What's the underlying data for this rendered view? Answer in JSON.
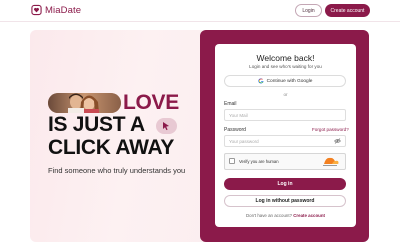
{
  "header": {
    "brand_name": "MiaDate",
    "login_label": "Login",
    "create_account_label": "Create account"
  },
  "hero": {
    "word_highlight": "LOVE",
    "line2": "IS JUST A",
    "line3": "CLICK AWAY",
    "subtitle": "Find someone who truly understands you"
  },
  "login_card": {
    "title": "Welcome back!",
    "subtitle": "Login and see who's waiting for you",
    "google_button_label": "Continue with Google",
    "divider_text": "or",
    "email_label": "Email",
    "email_placeholder": "Your Mail",
    "password_label": "Password",
    "forgot_password_label": "Forgot password?",
    "password_placeholder": "Your password",
    "captcha_label": "Verify you are human",
    "login_button_label": "Log in",
    "login_without_password_label": "Log in without password",
    "footer_prompt": "Don't have an account?",
    "footer_link": "Create account"
  },
  "colors": {
    "brand": "#8b1a4a",
    "hero_background": "#fdf1f2",
    "card_background": "#ffffff"
  },
  "icons": {
    "brand": "heart-photo-icon",
    "google": "google-g-icon",
    "eye": "eye-icon",
    "cursor": "mouse-cursor-icon",
    "captcha": "captcha-shield-icon"
  }
}
